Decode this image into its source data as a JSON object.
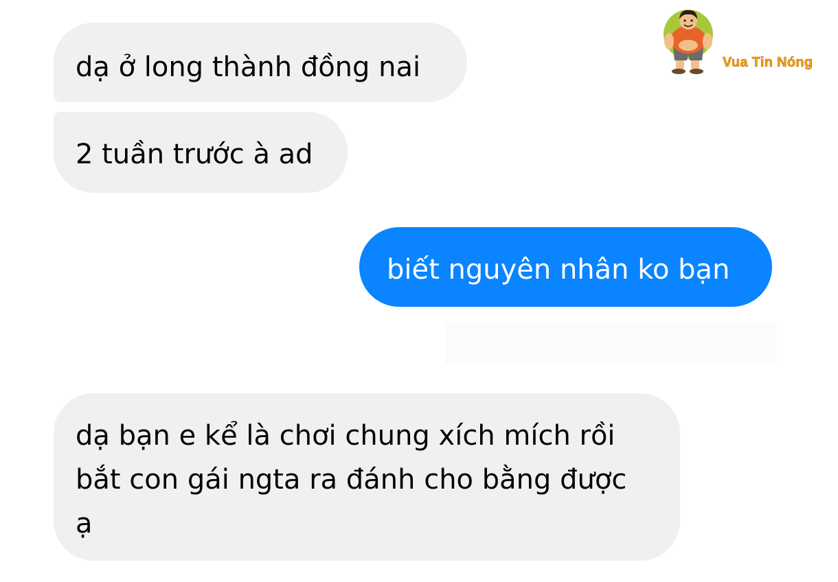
{
  "messages": [
    {
      "direction": "incoming",
      "text": "dạ ở long thành đồng nai"
    },
    {
      "direction": "incoming",
      "text": "2 tuần trước à ad"
    },
    {
      "direction": "outgoing",
      "text": "biết nguyên nhân ko bạn"
    },
    {
      "direction": "incoming",
      "lines": [
        "dạ bạn e kể là chơi chung xích mích rồi",
        "bắt con gái ngta ra đánh cho bằng được",
        "ạ"
      ]
    }
  ],
  "watermark": {
    "text": "Vua Tin Nóng",
    "icon": "mascot-logo-icon"
  },
  "colors": {
    "incoming_bubble": "#f0f0f0",
    "outgoing_bubble": "#0a84ff",
    "incoming_text": "#050505",
    "outgoing_text": "#ffffff",
    "watermark_text": "#f2a41b"
  }
}
